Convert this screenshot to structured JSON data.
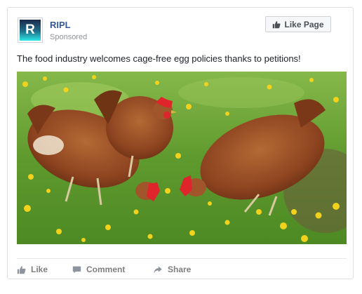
{
  "post": {
    "page_name": "RIPL",
    "avatar_letter": "R",
    "sponsored_label": "Sponsored",
    "like_page_label": "Like Page",
    "text": "The food industry welcomes cage-free egg policies thanks to petitions!",
    "image": {
      "subject": "chickens-pecking-in-dandelion-field",
      "icon_colors": {
        "grass": "#5e9a2c",
        "hen": "#9a4d22",
        "comb": "#e0242b",
        "flower": "#f2d21c"
      }
    }
  },
  "actions": [
    {
      "label": "Like",
      "icon": "thumbs-up-icon"
    },
    {
      "label": "Comment",
      "icon": "comment-icon"
    },
    {
      "label": "Share",
      "icon": "share-icon"
    }
  ]
}
